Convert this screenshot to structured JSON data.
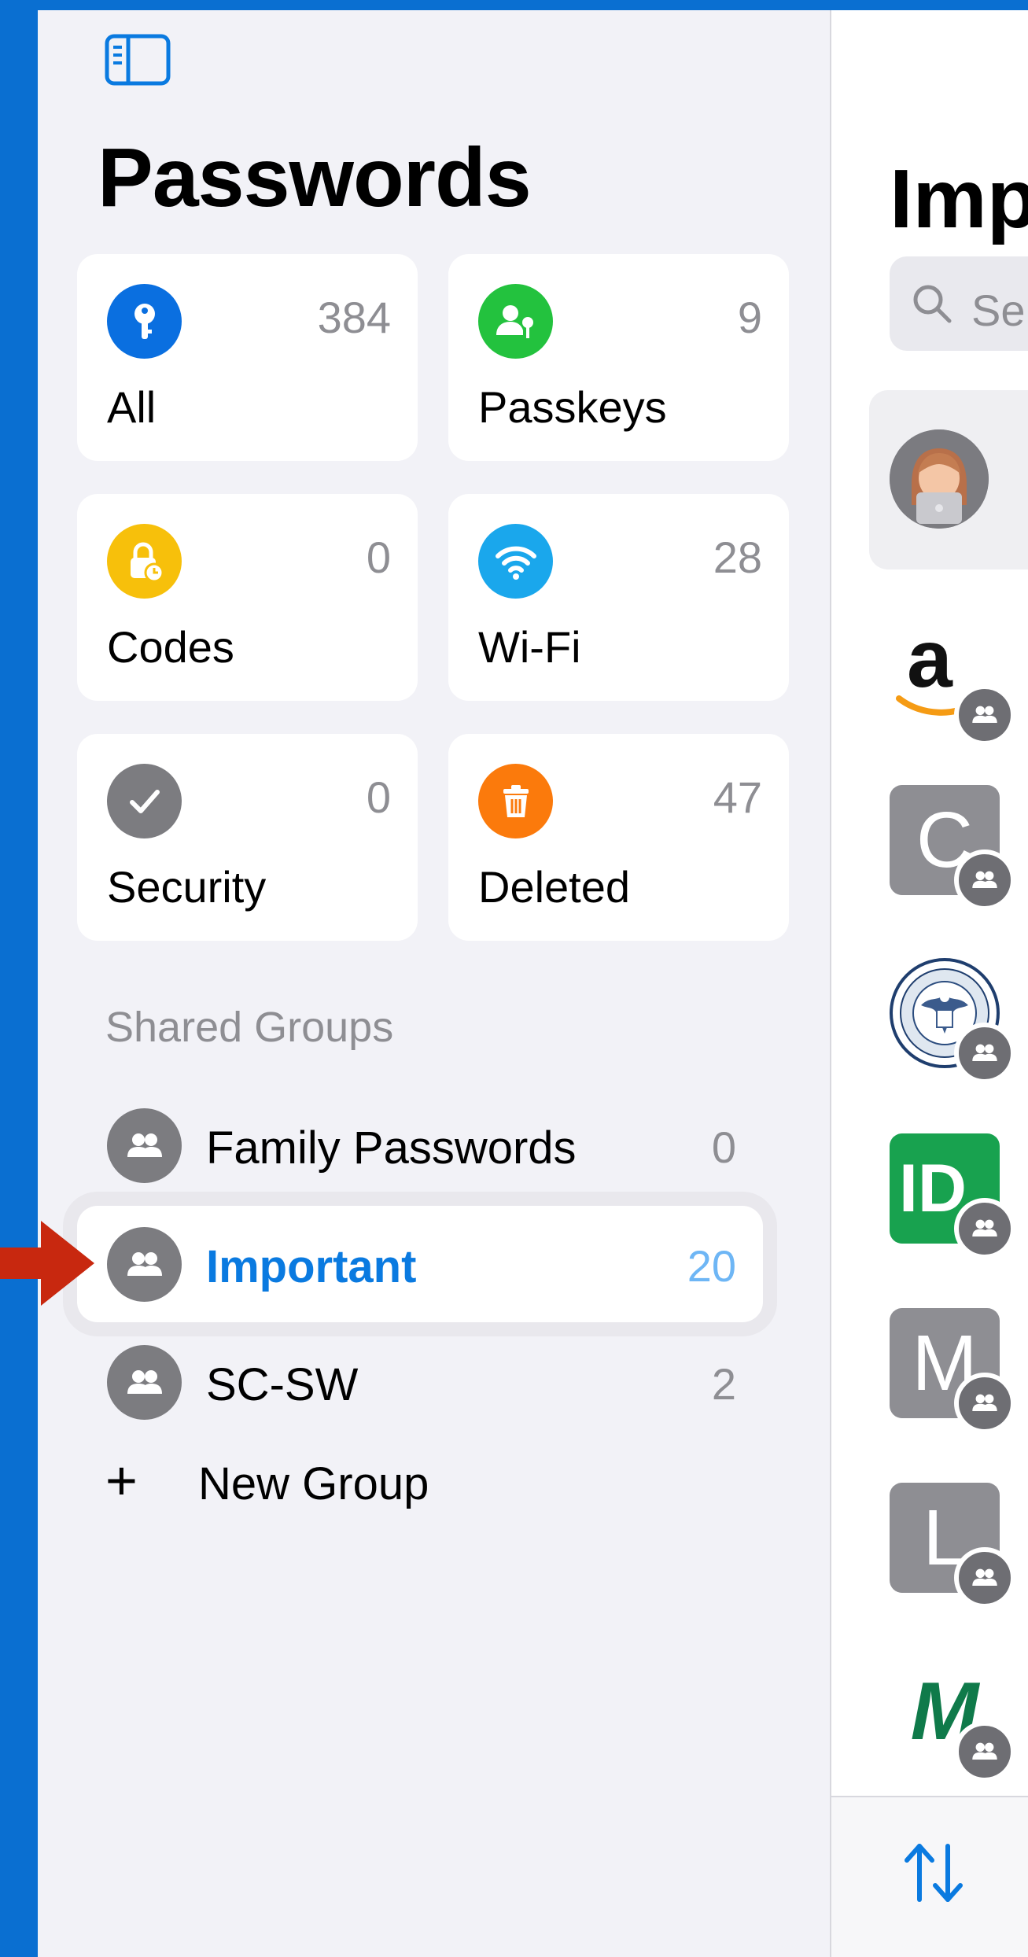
{
  "sidebar": {
    "title": "Passwords",
    "categories": [
      {
        "label": "All",
        "count": "384",
        "icon": "key-icon",
        "color": "#0a6fe0"
      },
      {
        "label": "Passkeys",
        "count": "9",
        "icon": "person-key-icon",
        "color": "#23c23e"
      },
      {
        "label": "Codes",
        "count": "0",
        "icon": "lock-clock-icon",
        "color": "#f7c00b"
      },
      {
        "label": "Wi-Fi",
        "count": "28",
        "icon": "wifi-icon",
        "color": "#1aa7ec"
      },
      {
        "label": "Security",
        "count": "0",
        "icon": "checkmark-icon",
        "color": "#7c7c80"
      },
      {
        "label": "Deleted",
        "count": "47",
        "icon": "trash-icon",
        "color": "#fb7a0c"
      }
    ],
    "shared_groups_header": "Shared Groups",
    "groups": [
      {
        "label": "Family Passwords",
        "count": "0"
      },
      {
        "label": "Important",
        "count": "20"
      },
      {
        "label": "SC-SW",
        "count": "2"
      }
    ],
    "new_group_label": "New Group",
    "new_group_icon": "plus-icon"
  },
  "main": {
    "title": "Imp",
    "search_placeholder": "Se",
    "items": [
      {
        "name": "amazon",
        "logo_text": "a"
      },
      {
        "name": "c",
        "logo_text": "C"
      },
      {
        "name": "homeland-security",
        "logo_text": ""
      },
      {
        "name": "id",
        "logo_text": "ID"
      },
      {
        "name": "m",
        "logo_text": "M"
      },
      {
        "name": "l",
        "logo_text": "L"
      },
      {
        "name": "m-green",
        "logo_text": "M"
      }
    ]
  },
  "colors": {
    "accent": "#0a7ae0",
    "background": "#f2f2f7",
    "annotation_arrow": "#c8280f"
  }
}
